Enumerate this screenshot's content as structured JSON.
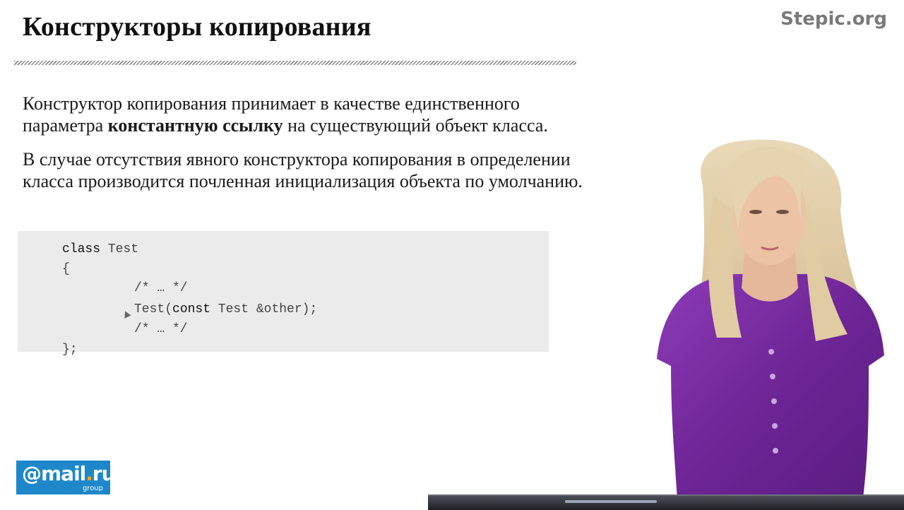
{
  "slide": {
    "title": "Конструкторы копирования",
    "brand": "Stepic.org",
    "p1_before": "Конструктор копирования принимает в качестве единственного параметра ",
    "p1_bold": "константную ссылку",
    "p1_after": " на существующий объект класса.",
    "p2": "В случае отсутствия явного конструктора копирования в определении класса производится почленная инициализация объекта по умолчанию.",
    "code": {
      "l1_kw": "class",
      "l1_rest": " Test",
      "l2": "{",
      "l3": "/* … */",
      "l4_a": "Test(",
      "l4_kw": "const",
      "l4_b": " Test &other);",
      "l5": "/* … */",
      "l6": "};"
    }
  },
  "logo": {
    "main_at": "@",
    "main_mail": "mail",
    "main_dot": ".",
    "main_ru": "ru",
    "sub": "group"
  },
  "colors": {
    "logo_bg": "#1d87c9",
    "logo_dot": "#f7a21b",
    "shirt": "#7a2fa3",
    "hair": "#e6d3b0"
  }
}
